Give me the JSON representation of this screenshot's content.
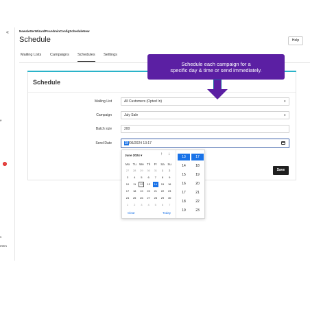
{
  "sidebar": {
    "collapse_glyph": "«",
    "fragments": [
      "e",
      "s",
      "eters"
    ],
    "badge": "!"
  },
  "breadcrumb": "NewsletterWizardProAdminConfigScheduleNew",
  "page_title": "Schedule",
  "help_label": "Help",
  "tabs": [
    {
      "label": "Mailing Lists",
      "active": false
    },
    {
      "label": "Campaigns",
      "active": false
    },
    {
      "label": "Schedules",
      "active": true
    },
    {
      "label": "Settings",
      "active": false
    }
  ],
  "section_title": "Schedule",
  "callout": {
    "line1": "Schedule each campaign for a",
    "line2": "specific day & time or send immediately."
  },
  "form": {
    "mailing_list": {
      "label": "Mailing List",
      "value": "All Customers (Opted In)"
    },
    "campaign": {
      "label": "Campaign",
      "value": "July Sale"
    },
    "batch_size": {
      "label": "Batch size",
      "value": "200"
    },
    "send_date": {
      "label": "Send Date",
      "selected": "18",
      "rest": "/06/2024 13:17"
    }
  },
  "save_label": "Save",
  "datepicker": {
    "month_label": "June 2024 ▾",
    "nav_up": "↑",
    "nav_down": "↓",
    "weekdays": [
      "Mo",
      "Tu",
      "We",
      "Th",
      "Fr",
      "Sa",
      "Su"
    ],
    "weeks": [
      [
        "27",
        "28",
        "29",
        "30",
        "31",
        "1",
        "2"
      ],
      [
        "3",
        "4",
        "5",
        "6",
        "7",
        "8",
        "9"
      ],
      [
        "10",
        "11",
        "12",
        "13",
        "14",
        "15",
        "16"
      ],
      [
        "17",
        "18",
        "19",
        "20",
        "21",
        "22",
        "23"
      ],
      [
        "24",
        "25",
        "26",
        "27",
        "28",
        "29",
        "30"
      ],
      [
        "1",
        "2",
        "3",
        "4",
        "5",
        "6",
        "7"
      ]
    ],
    "other_month_weeks": [
      0,
      5
    ],
    "other_month_first_row_count": 5,
    "today": "12",
    "selected": "14",
    "clear_label": "Clear",
    "today_label": "Today",
    "hours": [
      "13",
      "14",
      "15",
      "16",
      "17",
      "18",
      "19"
    ],
    "minutes": [
      "17",
      "18",
      "19",
      "20",
      "21",
      "22",
      "23"
    ],
    "selected_hour": "13",
    "selected_minute": "17"
  },
  "colors": {
    "accent": "#1a73e8",
    "callout": "#5b1fa3",
    "card_top": "#2ab3c9",
    "badge": "#e0302d"
  },
  "icons": [
    "chevrons-left-icon",
    "calendar-icon",
    "chevron-updown-icon",
    "arrow-down-icon"
  ]
}
